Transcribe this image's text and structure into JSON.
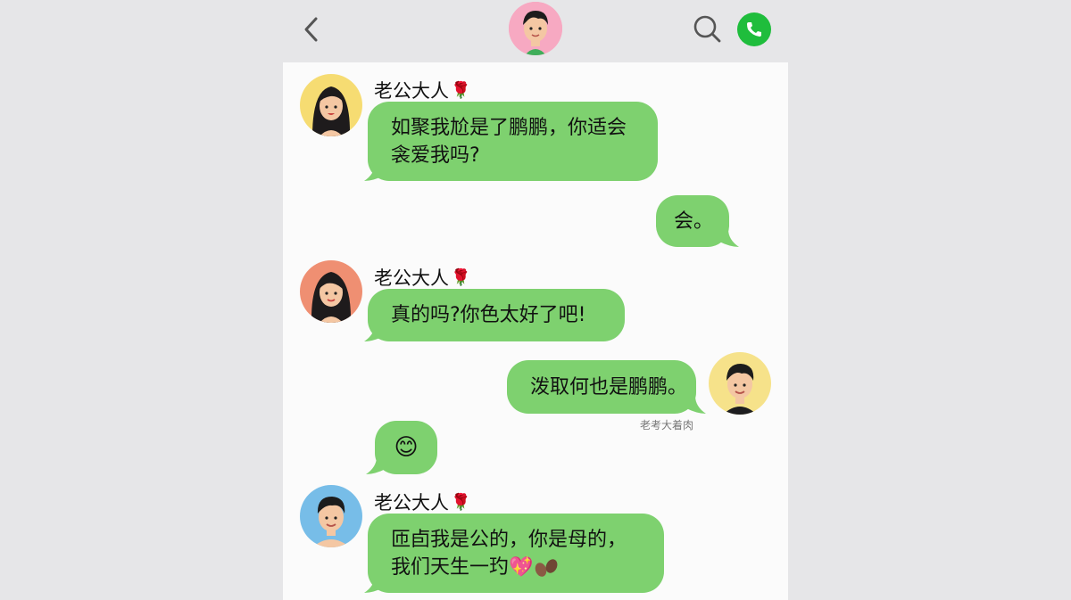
{
  "header": {
    "back_icon": "chevron-left-icon",
    "search_icon": "search-icon",
    "call_icon": "phone-icon",
    "accent": "#1fbd3c"
  },
  "messages": [
    {
      "sender": "老公大人",
      "sender_badge": "🌹",
      "line1": "如聚我尬是了鹏鹏，你适会",
      "line2": "衾爱我吗?"
    },
    {
      "sender": "self",
      "line1": "会。"
    },
    {
      "sender": "老公大人",
      "sender_badge": "🌹",
      "line1": "真的吗?你色太好了吧!"
    },
    {
      "sender": "self",
      "line1": "泼取何也是鹏鹏。",
      "caption": "老考大着肉"
    },
    {
      "sender": "other",
      "emoji": "😊"
    },
    {
      "sender": "老公大人",
      "sender_badge": "🌹",
      "line1": "匝卣我是公的，你是母的，",
      "line2": "我们天生一玓",
      "line2_emoji": "💖"
    }
  ],
  "colors": {
    "bubble": "#7ed16f",
    "panel": "#fbfbfb",
    "background": "#e6e6e8"
  }
}
